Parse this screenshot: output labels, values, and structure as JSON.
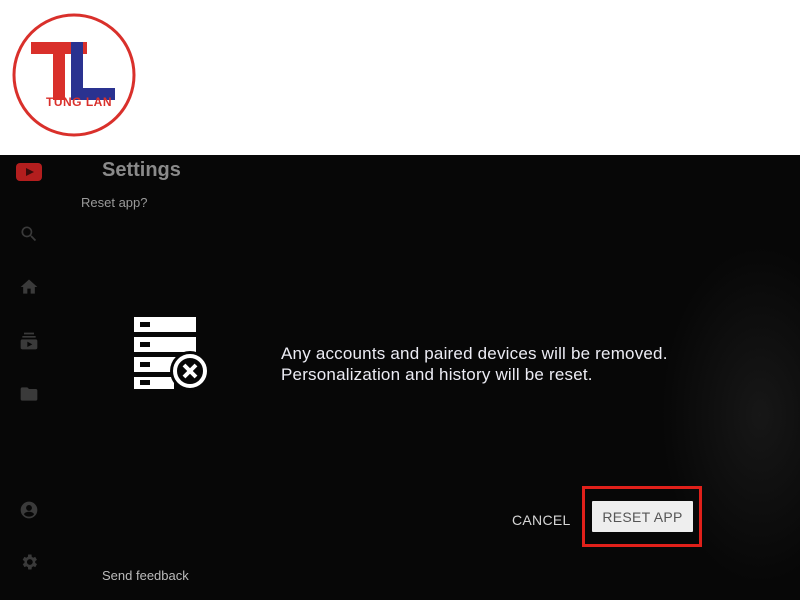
{
  "logo": {
    "text": "TUNG LAN",
    "ring_color": "#d9302b",
    "blue": "#2a3290",
    "red": "#d9302b"
  },
  "settings": {
    "title": "Settings",
    "subtitle": "Reset app?",
    "feedback_label": "Send feedback"
  },
  "dialog": {
    "message": "Any accounts and paired devices will be removed. Personalization and history will be reset.",
    "cancel_label": "CANCEL",
    "reset_label": "RESET APP",
    "highlight_color": "#e0201a"
  },
  "rail": {
    "icons": [
      "youtube-icon",
      "search-icon",
      "home-icon",
      "subscriptions-icon",
      "library-icon",
      "account-icon",
      "gear-icon"
    ]
  }
}
